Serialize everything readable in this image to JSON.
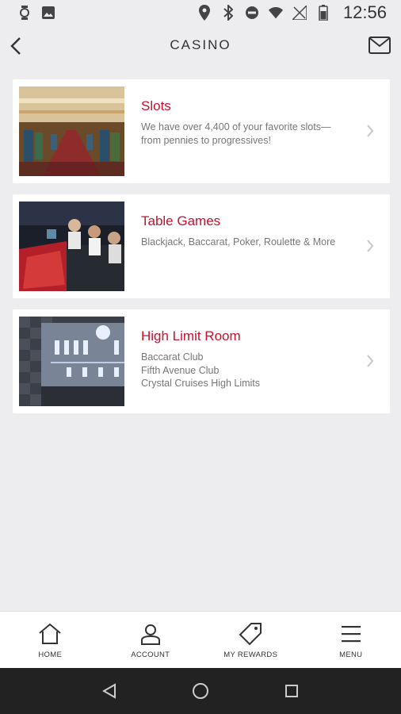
{
  "status_bar": {
    "time": "12:56",
    "icons_left": [
      "lock-watch-icon",
      "image-icon"
    ],
    "icons_right": [
      "location-icon",
      "bluetooth-icon",
      "do-not-disturb-icon",
      "wifi-icon",
      "no-signal-icon",
      "battery-icon"
    ]
  },
  "header": {
    "title": "CASINO",
    "back_icon": "chevron-left-icon",
    "mail_icon": "mail-icon"
  },
  "cards": [
    {
      "title": "Slots",
      "description": "We have over 4,400 of your favorite slots—from pennies to progressives!",
      "image": "slots-photo"
    },
    {
      "title": "Table Games",
      "description": "Blackjack, Baccarat, Poker, Roulette & More",
      "image": "table-games-photo"
    },
    {
      "title": "High Limit Room",
      "description_lines": [
        "Baccarat Club",
        "Fifth Avenue Club",
        "Crystal Cruises High Limits"
      ],
      "image": "high-limit-room-photo"
    }
  ],
  "bottom_nav": [
    {
      "label": "HOME",
      "icon": "home-icon"
    },
    {
      "label": "ACCOUNT",
      "icon": "account-icon"
    },
    {
      "label": "MY REWARDS",
      "icon": "tag-icon"
    },
    {
      "label": "MENU",
      "icon": "menu-icon"
    }
  ],
  "colors": {
    "accent": "#c8102e",
    "background": "#ededef",
    "card": "#ffffff"
  }
}
